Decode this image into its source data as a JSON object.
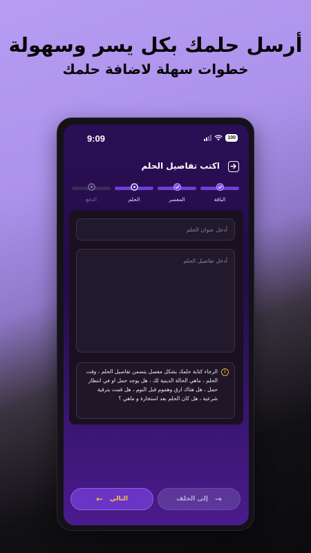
{
  "promo": {
    "headline": "أرسل حلمك بكل يسر وسهولة",
    "subheadline": "خطوات سهلة لاضافة حلمك"
  },
  "status_bar": {
    "time": "9:09",
    "battery": "100"
  },
  "header": {
    "title": "اكتب تفاصيل الحلم",
    "back_icon": "arrow-right-box-icon"
  },
  "stepper": {
    "steps": [
      {
        "label": "الباقة",
        "state": "done"
      },
      {
        "label": "المفسر",
        "state": "done"
      },
      {
        "label": "الحلم",
        "state": "current"
      },
      {
        "label": "الدفع",
        "state": "todo"
      }
    ]
  },
  "form": {
    "title_placeholder": "أدخل عنوان الحلم",
    "details_placeholder": "أدخل تفاصيل الحلم",
    "notice_icon": "info-icon",
    "notice_text": "الرجاء كتابة حلمك بشكل مفصل يتضمن تفاصيل الحلم ، وقت الحلم ، ماهي الحالة الدينية لك ، هل يوجد حمل او في انتظار حمل ، هل هناك ارق وهموم قبل النوم ، هل قمت بترقية شرعية ، هل كان الحلم بعد استخارة و ماهي ؟"
  },
  "buttons": {
    "back_label": "إلى الخلف",
    "next_label": "التالي"
  },
  "colors": {
    "accent": "#6a35c4",
    "next_text": "#f2c14a",
    "info": "#e2b23a"
  }
}
